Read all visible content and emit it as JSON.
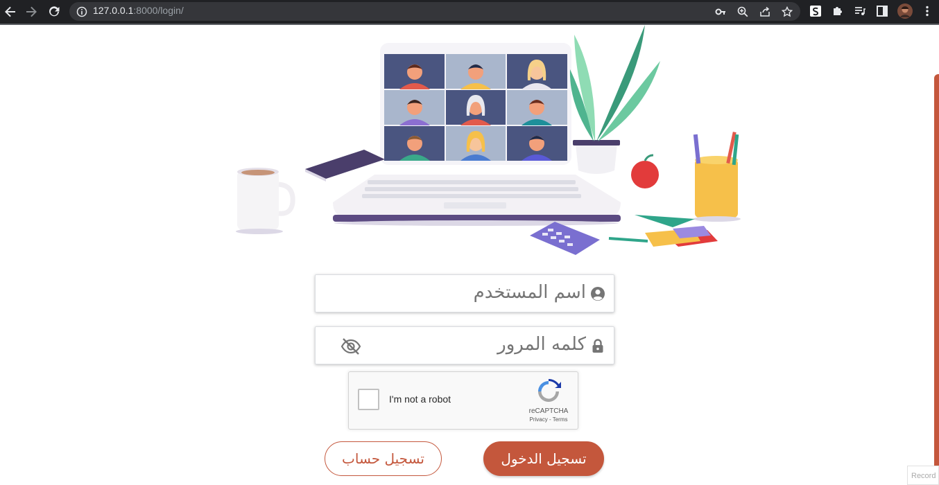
{
  "browser": {
    "url_host": "127.0.0.1",
    "url_rest": ":8000/login/",
    "icons": [
      "back-icon",
      "forward-icon",
      "reload-icon",
      "site-info-icon",
      "key-icon",
      "zoom-icon",
      "share-icon",
      "bookmark-star-icon",
      "s-extension-icon",
      "puzzle-icon",
      "media-icon",
      "side-panel-icon",
      "profile-avatar",
      "menu-icon"
    ]
  },
  "form": {
    "username_label": "اسم المستخدم",
    "password_label": "كلمه المرور"
  },
  "recaptcha": {
    "label": "I'm not a robot",
    "brand": "reCAPTCHA",
    "links": "Privacy - Terms"
  },
  "buttons": {
    "login": "تسجيل الدخول",
    "register": "تسجيل حساب"
  },
  "badge": {
    "text": "Record"
  },
  "colors": {
    "accent": "#c4573c",
    "chrome_bg": "#202124",
    "omnibox_bg": "#35363a"
  }
}
